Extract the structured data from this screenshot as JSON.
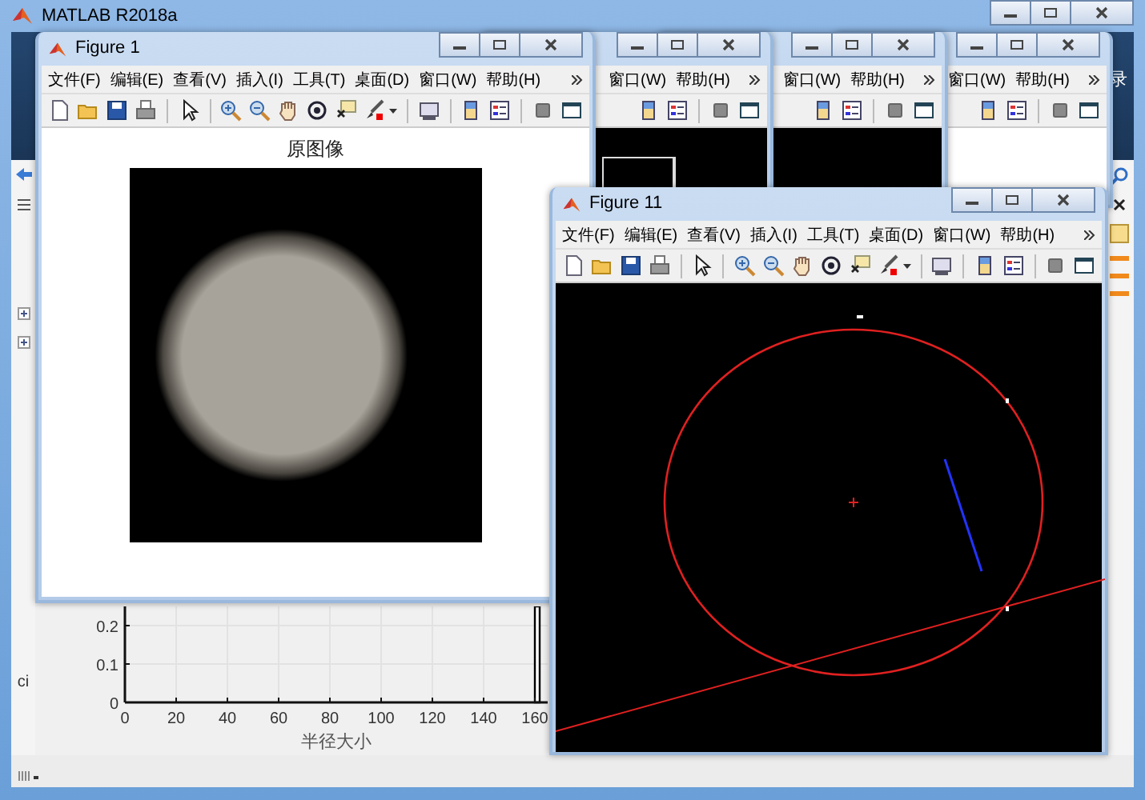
{
  "main_window": {
    "title": "MATLAB R2018a",
    "toolstrip_label": "录",
    "panel_label": "ci",
    "plot": {
      "chart_data": {
        "type": "bar",
        "grid": true,
        "xlabel": "半径大小",
        "x": [
          160
        ],
        "values": [
          0.25
        ],
        "xlim": [
          0,
          165
        ],
        "ylim": [
          0,
          0.25
        ],
        "xticks": [
          0,
          20,
          40,
          60,
          80,
          100,
          120,
          140,
          160
        ],
        "yticks": [
          0,
          0.1,
          0.2
        ]
      }
    }
  },
  "background_figures": [
    {
      "menu": [
        "窗口(W)",
        "帮助(H)"
      ]
    },
    {
      "menu": [
        "窗口(W)",
        "帮助(H)"
      ]
    },
    {
      "menu": [
        "窗口(W)",
        "帮助(H)"
      ]
    }
  ],
  "figures": [
    {
      "kind": "image",
      "title": "Figure 1",
      "menu": [
        "文件(F)",
        "编辑(E)",
        "查看(V)",
        "插入(I)",
        "工具(T)",
        "桌面(D)",
        "窗口(W)",
        "帮助(H)"
      ],
      "axes_title": "原图像"
    },
    {
      "kind": "detection",
      "title": "Figure 11",
      "menu": [
        "文件(F)",
        "编辑(E)",
        "查看(V)",
        "插入(I)",
        "工具(T)",
        "桌面(D)",
        "窗口(W)",
        "帮助(H)"
      ]
    }
  ]
}
